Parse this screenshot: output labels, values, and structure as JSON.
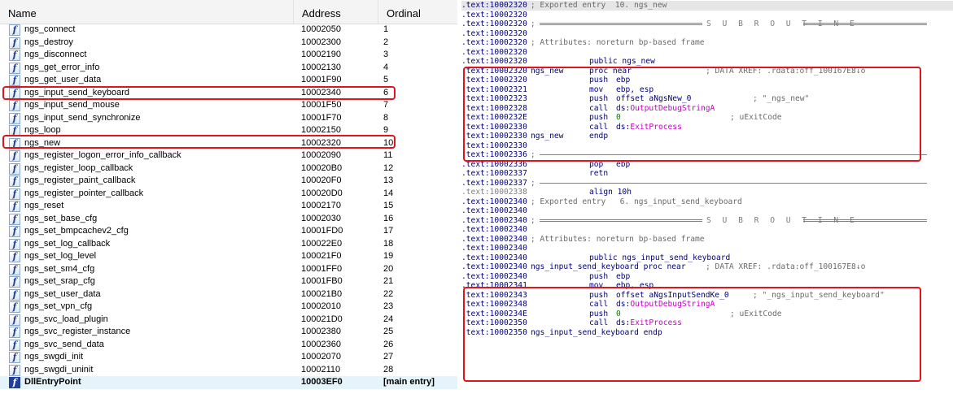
{
  "exports": {
    "columns": [
      "Name",
      "Address",
      "Ordinal"
    ],
    "icon_glyph": "f",
    "rows": [
      {
        "name": "ngs_connect",
        "address": "10002050",
        "ordinal": "1"
      },
      {
        "name": "ngs_destroy",
        "address": "10002300",
        "ordinal": "2"
      },
      {
        "name": "ngs_disconnect",
        "address": "10002190",
        "ordinal": "3"
      },
      {
        "name": "ngs_get_error_info",
        "address": "10002130",
        "ordinal": "4"
      },
      {
        "name": "ngs_get_user_data",
        "address": "10001F90",
        "ordinal": "5"
      },
      {
        "name": "ngs_input_send_keyboard",
        "address": "10002340",
        "ordinal": "6"
      },
      {
        "name": "ngs_input_send_mouse",
        "address": "10001F50",
        "ordinal": "7"
      },
      {
        "name": "ngs_input_send_synchronize",
        "address": "10001F70",
        "ordinal": "8"
      },
      {
        "name": "ngs_loop",
        "address": "10002150",
        "ordinal": "9"
      },
      {
        "name": "ngs_new",
        "address": "10002320",
        "ordinal": "10"
      },
      {
        "name": "ngs_register_logon_error_info_callback",
        "address": "10002090",
        "ordinal": "11"
      },
      {
        "name": "ngs_register_loop_callback",
        "address": "100020B0",
        "ordinal": "12"
      },
      {
        "name": "ngs_register_paint_callback",
        "address": "100020F0",
        "ordinal": "13"
      },
      {
        "name": "ngs_register_pointer_callback",
        "address": "100020D0",
        "ordinal": "14"
      },
      {
        "name": "ngs_reset",
        "address": "10002170",
        "ordinal": "15"
      },
      {
        "name": "ngs_set_base_cfg",
        "address": "10002030",
        "ordinal": "16"
      },
      {
        "name": "ngs_set_bmpcachev2_cfg",
        "address": "10001FD0",
        "ordinal": "17"
      },
      {
        "name": "ngs_set_log_callback",
        "address": "100022E0",
        "ordinal": "18"
      },
      {
        "name": "ngs_set_log_level",
        "address": "100021F0",
        "ordinal": "19"
      },
      {
        "name": "ngs_set_sm4_cfg",
        "address": "10001FF0",
        "ordinal": "20"
      },
      {
        "name": "ngs_set_srap_cfg",
        "address": "10001FB0",
        "ordinal": "21"
      },
      {
        "name": "ngs_set_user_data",
        "address": "100021B0",
        "ordinal": "22"
      },
      {
        "name": "ngs_set_vpn_cfg",
        "address": "10002010",
        "ordinal": "23"
      },
      {
        "name": "ngs_svc_load_plugin",
        "address": "100021D0",
        "ordinal": "24"
      },
      {
        "name": "ngs_svc_register_instance",
        "address": "10002380",
        "ordinal": "25"
      },
      {
        "name": "ngs_svc_send_data",
        "address": "10002360",
        "ordinal": "26"
      },
      {
        "name": "ngs_swgdi_init",
        "address": "10002070",
        "ordinal": "27"
      },
      {
        "name": "ngs_swgdi_uninit",
        "address": "10002110",
        "ordinal": "28"
      },
      {
        "name": "DllEntryPoint",
        "address": "10003EF0",
        "ordinal": "[main entry]"
      }
    ]
  },
  "disasm": {
    "seg": ".text:",
    "lines": [
      {
        "addr": "10002320",
        "kind": "comment",
        "text": "; Exported entry  10. ngs_new"
      },
      {
        "addr": "10002320",
        "kind": "blank"
      },
      {
        "addr": "10002320",
        "kind": "subroutine",
        "semi": ";",
        "banner": "S U B R O U T I N E"
      },
      {
        "addr": "10002320",
        "kind": "blank"
      },
      {
        "addr": "10002320",
        "kind": "comment",
        "text": "; Attributes: noreturn bp-based frame"
      },
      {
        "addr": "10002320",
        "kind": "blank"
      },
      {
        "addr": "10002320",
        "kind": "public",
        "text": "public ngs_new"
      },
      {
        "addr": "10002320",
        "kind": "proc",
        "label": "ngs_new",
        "mn": "proc near",
        "cmt": "; DATA XREF: .rdata:off_100167E8↓o"
      },
      {
        "addr": "10002320",
        "kind": "ins",
        "mn": "push",
        "op": "ebp"
      },
      {
        "addr": "10002321",
        "kind": "ins",
        "mn": "mov",
        "op": "ebp, esp"
      },
      {
        "addr": "10002323",
        "kind": "ins",
        "mn": "push",
        "op": "offset aNgsNew_0",
        "cmt": "; \"_ngs_new\""
      },
      {
        "addr": "10002328",
        "kind": "call",
        "mn": "call",
        "op_pre": "ds:",
        "api": "OutputDebugStringA"
      },
      {
        "addr": "1000232E",
        "kind": "pushnum",
        "mn": "push",
        "num": "0",
        "cmt": "; uExitCode"
      },
      {
        "addr": "10002330",
        "kind": "call",
        "mn": "call",
        "op_pre": "ds:",
        "api": "ExitProcess"
      },
      {
        "addr": "10002330",
        "kind": "endp",
        "label": "ngs_new",
        "mn": "endp"
      },
      {
        "addr": "10002330",
        "kind": "blank"
      },
      {
        "addr": "10002336",
        "kind": "rule",
        "semi": ";"
      },
      {
        "addr": "10002336",
        "kind": "ins",
        "mn": "pop",
        "op": "ebp"
      },
      {
        "addr": "10002337",
        "kind": "ins",
        "mn": "retn",
        "op": ""
      },
      {
        "addr": "10002337",
        "kind": "rule",
        "semi": ";"
      },
      {
        "addr": "10002338",
        "kind": "align",
        "mn": "align 10h",
        "gray": true
      },
      {
        "addr": "10002340",
        "kind": "comment",
        "text": "; Exported entry   6. ngs_input_send_keyboard"
      },
      {
        "addr": "10002340",
        "kind": "blank"
      },
      {
        "addr": "10002340",
        "kind": "subroutine",
        "semi": ";",
        "banner": "S U B R O U T I N E"
      },
      {
        "addr": "10002340",
        "kind": "blank"
      },
      {
        "addr": "10002340",
        "kind": "comment",
        "text": "; Attributes: noreturn bp-based frame"
      },
      {
        "addr": "10002340",
        "kind": "blank"
      },
      {
        "addr": "10002340",
        "kind": "public",
        "text": "public ngs_input_send_keyboard"
      },
      {
        "addr": "10002340",
        "kind": "proc2",
        "label": "ngs_input_send_keyboard proc near",
        "cmt": "; DATA XREF: .rdata:off_100167E8↓o"
      },
      {
        "addr": "10002340",
        "kind": "ins",
        "mn": "push",
        "op": "ebp"
      },
      {
        "addr": "10002341",
        "kind": "ins",
        "mn": "mov",
        "op": "ebp, esp"
      },
      {
        "addr": "10002343",
        "kind": "ins",
        "mn": "push",
        "op": "offset aNgsInputSendKe_0",
        "cmt": "; \"_ngs_input_send_keyboard\""
      },
      {
        "addr": "10002348",
        "kind": "call",
        "mn": "call",
        "op_pre": "ds:",
        "api": "OutputDebugStringA"
      },
      {
        "addr": "1000234E",
        "kind": "pushnum",
        "mn": "push",
        "num": "0",
        "cmt": "; uExitCode"
      },
      {
        "addr": "10002350",
        "kind": "call",
        "mn": "call",
        "op_pre": "ds:",
        "api": "ExitProcess"
      },
      {
        "addr": "10002350",
        "kind": "endp2",
        "label": "ngs_input_send_keyboard endp"
      }
    ]
  },
  "colors": {
    "highlight_border": "#e0141c",
    "code_blue": "#000080",
    "api_magenta": "#c800c8",
    "number_green": "#008000"
  }
}
